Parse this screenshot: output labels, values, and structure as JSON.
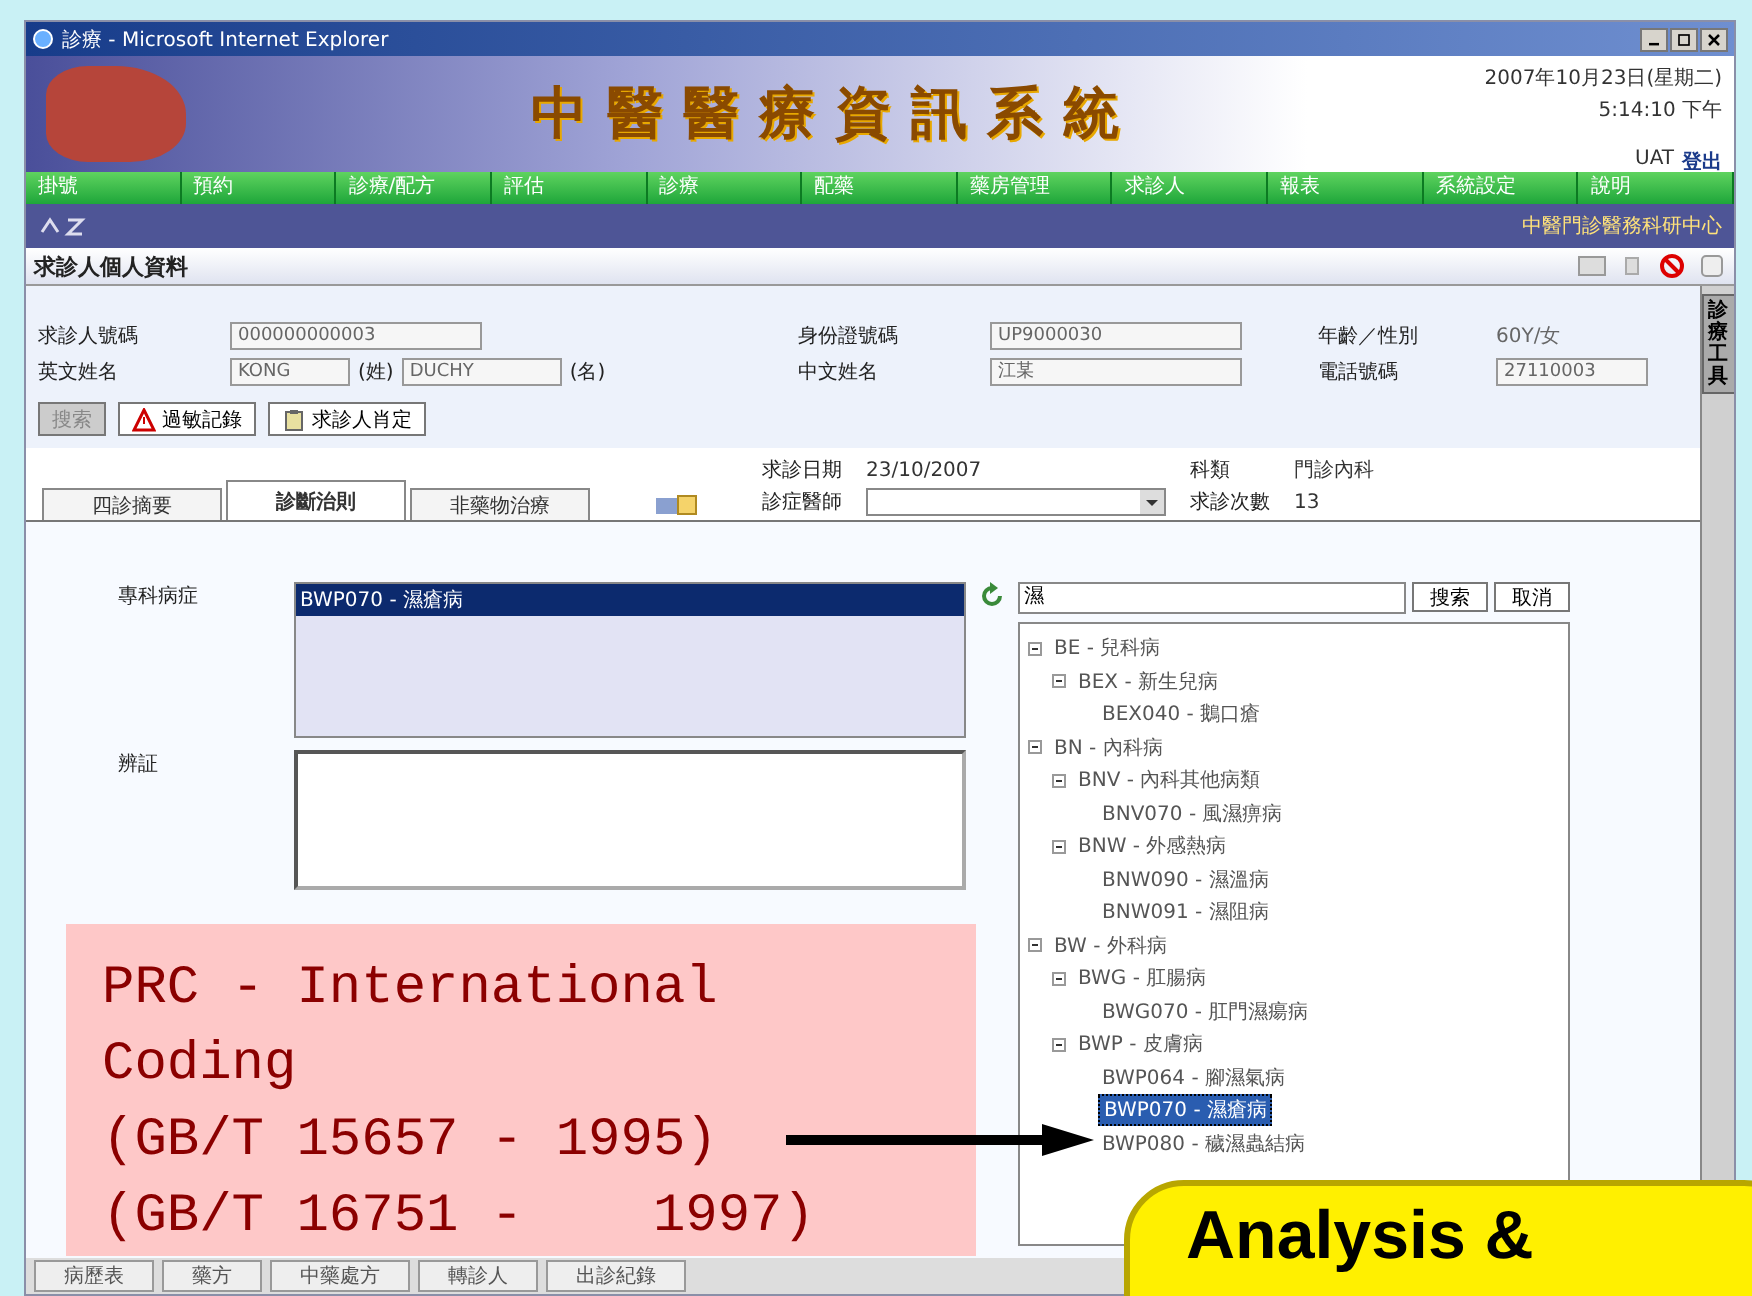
{
  "window": {
    "title": "診療 - Microsoft Internet Explorer"
  },
  "header": {
    "system_title": "中醫醫療資訊系統",
    "date": "2007年10月23日(星期二)",
    "time": "5:14:10 下午",
    "user": "UAT",
    "logout": "登出"
  },
  "menu": [
    "掛號",
    "預約",
    "診療/配方",
    "評估",
    "診療",
    "配藥",
    "藥房管理",
    "求診人",
    "報表",
    "系統設定",
    "說明"
  ],
  "subbar": {
    "centre": "中醫門診醫務科研中心"
  },
  "section_title": "求診人個人資料",
  "patient": {
    "rows": [
      [
        {
          "kind": "field",
          "label": "求診人號碼",
          "value": "000000000003"
        },
        {
          "kind": "field",
          "label": "身份證號碼",
          "value": "UP9000030"
        },
        {
          "kind": "text",
          "label": "年齡／性別",
          "value": "60Y/女"
        }
      ],
      [
        {
          "kind": "name",
          "label": "英文姓名",
          "surname": "KONG",
          "surname_label": "(姓)",
          "given": "DUCHY",
          "given_label": "(名)"
        },
        {
          "kind": "field",
          "label": "中文姓名",
          "value": "江某"
        },
        {
          "kind": "field",
          "label": "電話號碼",
          "value": "27110003"
        }
      ]
    ],
    "buttons": [
      {
        "kind": "plain",
        "label": "搜索",
        "disabled": true
      },
      {
        "kind": "warning",
        "label": "過敏記錄",
        "disabled": false
      },
      {
        "kind": "clipboard",
        "label": "求診人肖定",
        "disabled": false
      }
    ]
  },
  "tabs": [
    {
      "label": "四診摘要",
      "selected": false
    },
    {
      "label": "診斷治則",
      "selected": true
    },
    {
      "label": "非藥物治療",
      "selected": false
    }
  ],
  "visit": [
    {
      "kind": "text",
      "label": "求診日期",
      "value": "23/10/2007"
    },
    {
      "kind": "text",
      "label": "科類",
      "value": "門診內科"
    },
    {
      "kind": "select",
      "label": "診症醫師"
    },
    {
      "kind": "text",
      "label": "求診次數",
      "value": "13"
    }
  ],
  "diagnosis": {
    "specialty_label": "專科病症",
    "selected_item": "BWP070 - 濕瘡病",
    "syndrome_label": "辨証"
  },
  "tree": {
    "search_value": "濕",
    "buttons": [
      "搜索",
      "取消"
    ],
    "items": [
      {
        "label": "BE - 兒科病",
        "selected": false,
        "children": [
          {
            "label": "BEX - 新生兒病",
            "selected": false,
            "children": [
              {
                "label": "BEX040 - 鵝口瘡",
                "selected": false
              }
            ]
          }
        ]
      },
      {
        "label": "BN - 內科病",
        "selected": false,
        "children": [
          {
            "label": "BNV - 內科其他病類",
            "selected": false,
            "children": [
              {
                "label": "BNV070 - 風濕痹病",
                "selected": false
              }
            ]
          },
          {
            "label": "BNW - 外感熱病",
            "selected": false,
            "children": [
              {
                "label": "BNW090 - 濕溫病",
                "selected": false
              },
              {
                "label": "BNW091 - 濕阻病",
                "selected": false
              }
            ]
          }
        ]
      },
      {
        "label": "BW - 外科病",
        "selected": false,
        "children": [
          {
            "label": "BWG - 肛腸病",
            "selected": false,
            "children": [
              {
                "label": "BWG070 - 肛門濕瘍病",
                "selected": false
              }
            ]
          },
          {
            "label": "BWP - 皮膚病",
            "selected": false,
            "children": [
              {
                "label": "BWP064 - 腳濕氣病",
                "selected": false
              },
              {
                "label": "BWP070 - 濕瘡病",
                "selected": true
              },
              {
                "label": "BWP080 - 穢濕蟲結病",
                "selected": false
              }
            ]
          }
        ]
      }
    ]
  },
  "side_tab": "診療工具",
  "bottom_buttons": [
    "病歷表",
    "藥方",
    "中藥處方",
    "轉診人",
    "出診紀錄"
  ],
  "annotation": {
    "lines": [
      "PRC - International",
      "Coding",
      "(GB/T 15657 - 1995)",
      "(GB/T 16751 -    1997)"
    ]
  },
  "callout": {
    "text": "Analysis &"
  }
}
